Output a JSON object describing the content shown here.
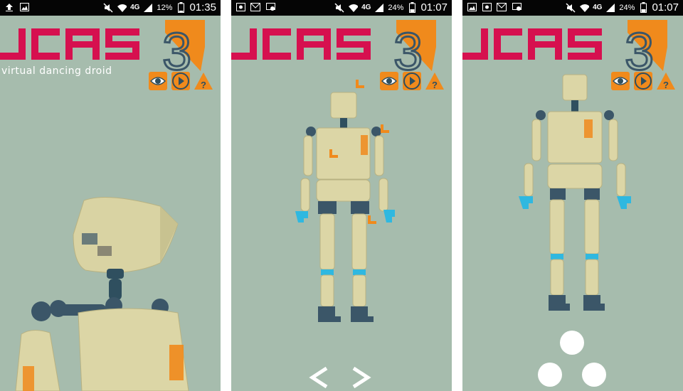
{
  "screens": [
    {
      "status": {
        "battery_percent": "12%",
        "time": "01:35",
        "network": "4G"
      },
      "logo": {
        "text": "JCAS",
        "number": "3",
        "subtitle": "virtual dancing droid"
      },
      "buttons": [
        "eye-icon",
        "play-icon",
        "help-icon"
      ]
    },
    {
      "status": {
        "battery_percent": "24%",
        "time": "01:07",
        "network": "4G"
      },
      "logo": {
        "text": "JCAS",
        "number": "3"
      },
      "buttons": [
        "eye-icon",
        "play-icon",
        "help-icon"
      ],
      "nav": {
        "prev": "<",
        "next": ">"
      }
    },
    {
      "status": {
        "battery_percent": "24%",
        "time": "01:07",
        "network": "4G"
      },
      "logo": {
        "text": "JCAS",
        "number": "3"
      },
      "buttons": [
        "eye-icon",
        "play-icon",
        "help-icon"
      ],
      "controls": [
        "dot-top",
        "dot-left",
        "dot-right"
      ]
    }
  ],
  "colors": {
    "background": "#a6bcad",
    "brand_magenta": "#d6104f",
    "brand_orange": "#f08a1c",
    "status_bar": "#050505",
    "robot_body": "#dcd6a6",
    "robot_joint": "#3b5668",
    "robot_hand": "#2fb8e0"
  }
}
